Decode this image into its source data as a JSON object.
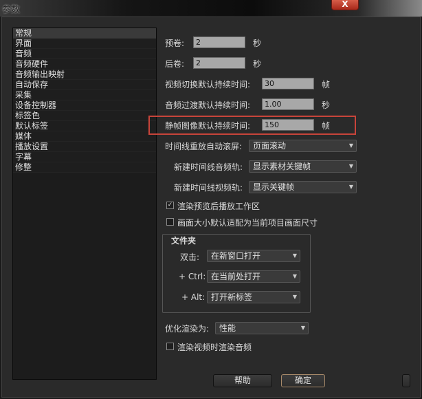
{
  "window": {
    "title": "参数",
    "close_label": "X"
  },
  "sidebar": {
    "items": [
      "常规",
      "界面",
      "音频",
      "音频硬件",
      "音频输出映射",
      "自动保存",
      "采集",
      "设备控制器",
      "标签色",
      "默认标签",
      "媒体",
      "播放设置",
      "字幕",
      "修整"
    ],
    "selected": 0
  },
  "general": {
    "preroll": {
      "label": "预卷:",
      "value": "2",
      "unit": "秒"
    },
    "postroll": {
      "label": "后卷:",
      "value": "2",
      "unit": "秒"
    },
    "video_transition": {
      "label": "视频切换默认持续时间:",
      "value": "30",
      "unit": "帧"
    },
    "audio_transition": {
      "label": "音频过渡默认持续时间:",
      "value": "1.00",
      "unit": "秒"
    },
    "still_image": {
      "label": "静帧图像默认持续时间:",
      "value": "150",
      "unit": "帧"
    },
    "timeline_scroll": {
      "label": "时间线重放自动滚屏:",
      "value": "页面滚动"
    },
    "new_audio_track": {
      "label": "新建时间线音频轨:",
      "value": "显示素材关键帧"
    },
    "new_video_track": {
      "label": "新建时间线视频轨:",
      "value": "显示关键帧"
    },
    "play_after_render": {
      "label": "渲染预览后播放工作区",
      "checked": true
    },
    "scale_to_frame": {
      "label": "画面大小默认适配为当前项目画面尺寸",
      "checked": false
    },
    "bins": {
      "title": "文件夹",
      "double_click": {
        "label": "双击:",
        "value": "在新窗口打开"
      },
      "ctrl": {
        "label": "+ Ctrl:",
        "value": "在当前处打开"
      },
      "alt": {
        "label": "+ Alt:",
        "value": "打开新标签"
      }
    },
    "optimize_render": {
      "label": "优化渲染为:",
      "value": "性能"
    },
    "render_audio": {
      "label": "渲染视频时渲染音频",
      "checked": false
    }
  },
  "buttons": {
    "help": "帮助",
    "ok": "确定"
  }
}
